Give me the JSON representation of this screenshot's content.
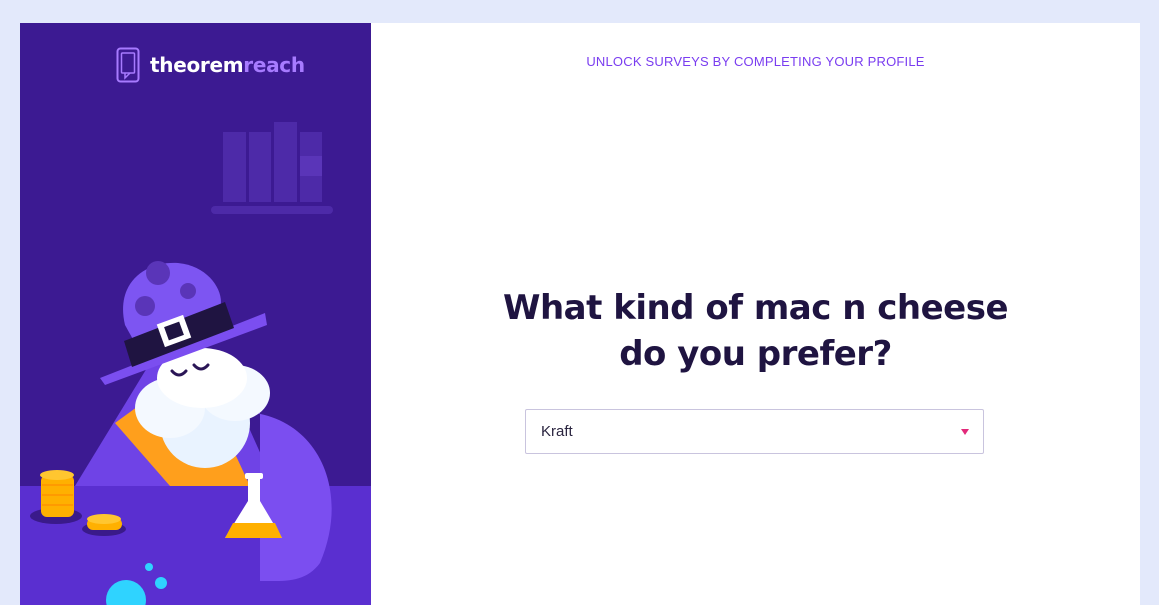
{
  "brand": {
    "name_part1": "theorem",
    "name_part2": "reach",
    "logo_icon": "phone-chat-icon",
    "accent_color": "#a77bff"
  },
  "banner": {
    "text": "UNLOCK SURVEYS BY COMPLETING YOUR PROFILE",
    "color": "#7a3df0"
  },
  "question": {
    "line1": "What kind of mac n cheese",
    "line2": "do you prefer?"
  },
  "answer_select": {
    "selected_value": "Kraft",
    "caret_icon": "caret-down-icon",
    "caret_color": "#e2297a"
  },
  "illustration": {
    "subject": "wizard-illustration",
    "background_color": "#3c1a92"
  }
}
